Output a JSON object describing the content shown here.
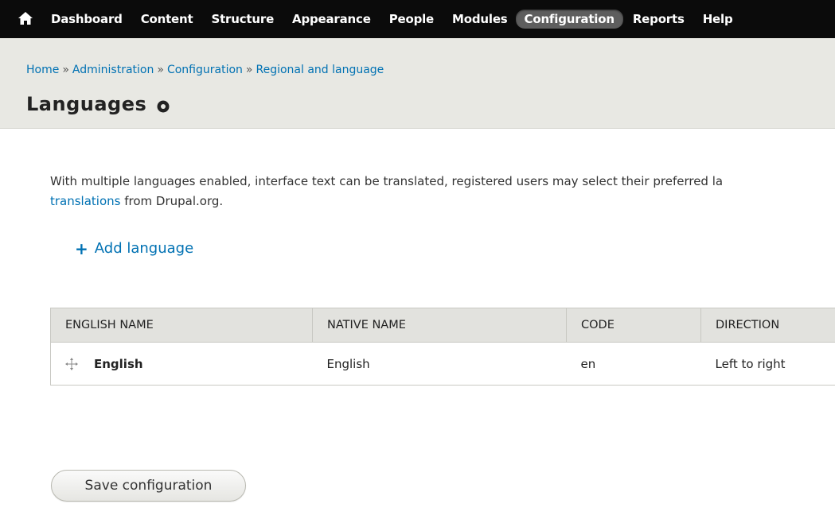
{
  "toolbar": {
    "home_icon": "home-icon",
    "items": [
      {
        "label": "Dashboard"
      },
      {
        "label": "Content"
      },
      {
        "label": "Structure"
      },
      {
        "label": "Appearance"
      },
      {
        "label": "People"
      },
      {
        "label": "Modules"
      },
      {
        "label": "Configuration",
        "active": true
      },
      {
        "label": "Reports"
      },
      {
        "label": "Help"
      }
    ]
  },
  "breadcrumb": {
    "items": [
      "Home",
      "Administration",
      "Configuration",
      "Regional and language"
    ],
    "separator": "»"
  },
  "page": {
    "title": "Languages",
    "shortcut_icon": "add-shortcut-icon"
  },
  "intro": {
    "text_before": "With multiple languages enabled, interface text can be translated, registered users may select their preferred la",
    "link_text": "translations",
    "text_after": " from Drupal.org."
  },
  "actions": {
    "add_language_label": "Add language"
  },
  "table": {
    "headers": [
      "ENGLISH NAME",
      "NATIVE NAME",
      "CODE",
      "DIRECTION"
    ],
    "rows": [
      {
        "english_name": "English",
        "native_name": "English",
        "code": "en",
        "direction": "Left to right"
      }
    ]
  },
  "form": {
    "save_label": "Save configuration"
  },
  "colors": {
    "toolbar_bg": "#0b0b0b",
    "link": "#0071b3",
    "header_band": "#e8e8e3",
    "table_header": "#e2e2de"
  }
}
